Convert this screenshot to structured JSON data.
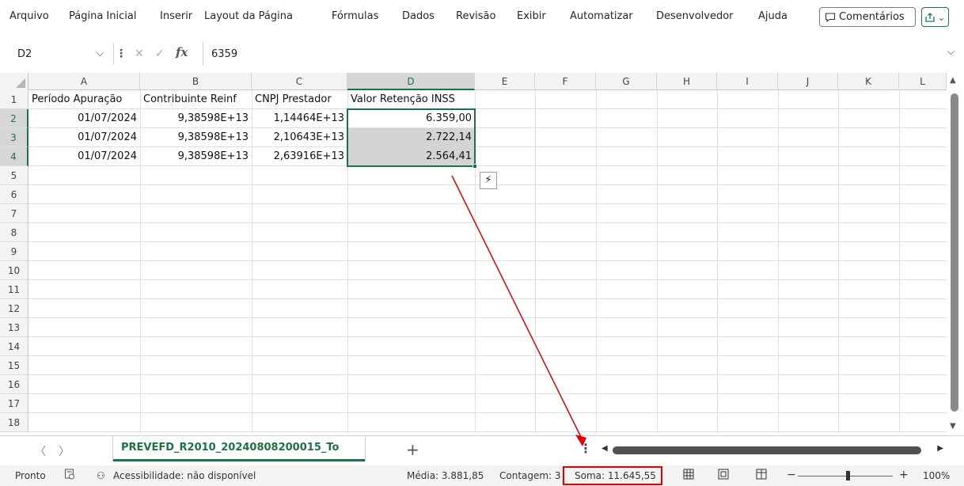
{
  "ribbon": {
    "tabs": [
      "Arquivo",
      "Página Inicial",
      "Inserir",
      "Layout da Página",
      "Fórmulas",
      "Dados",
      "Revisão",
      "Exibir",
      "Automatizar",
      "Desenvolvedor",
      "Ajuda"
    ],
    "comments_label": "Comentários",
    "share_icon": "share-icon"
  },
  "formula_bar": {
    "name_box": "D2",
    "fx": "fx",
    "value": "6359"
  },
  "columns": [
    "A",
    "B",
    "C",
    "D",
    "E",
    "F",
    "G",
    "H",
    "I",
    "J",
    "K",
    "L"
  ],
  "rows": [
    "1",
    "2",
    "3",
    "4",
    "5",
    "6",
    "7",
    "8",
    "9",
    "10",
    "11",
    "12",
    "13",
    "14",
    "15",
    "16",
    "17",
    "18"
  ],
  "cells": {
    "header": [
      "Período Apuração",
      "Contribuinte Reinf",
      "CNPJ Prestador",
      "Valor Retenção INSS"
    ],
    "data": [
      [
        "01/07/2024",
        "9,38598E+13",
        "1,14464E+13",
        "6.359,00"
      ],
      [
        "01/07/2024",
        "9,38598E+13",
        "2,10643E+13",
        "2.722,14"
      ],
      [
        "01/07/2024",
        "9,38598E+13",
        "2,63916E+13",
        "2.564,41"
      ]
    ]
  },
  "sheet": {
    "tab_name": "PREVEFD_R2010_20240808200015_To",
    "add": "+",
    "more": "⋮"
  },
  "status": {
    "ready": "Pronto",
    "accessibility": "Acessibilidade: não disponível",
    "average": "Média: 3.881,85",
    "count": "Contagem: 3",
    "sum": "Soma: 11.645,55",
    "zoom": "100%"
  },
  "colors": {
    "excel_green": "#1e7145",
    "annotation_red": "#e00000",
    "selection_fill": "#d4d4d4"
  }
}
